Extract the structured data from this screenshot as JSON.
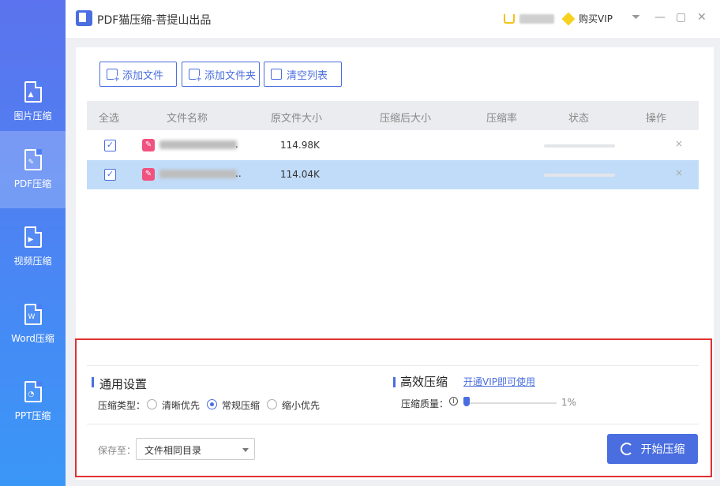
{
  "app": {
    "title": "PDF猫压缩-菩提山出品",
    "buy_vip": "购买VIP"
  },
  "sidebar": {
    "items": [
      {
        "label": "图片压缩",
        "icon": "image-file-icon"
      },
      {
        "label": "PDF压缩",
        "icon": "pdf-file-icon"
      },
      {
        "label": "视频压缩",
        "icon": "video-file-icon"
      },
      {
        "label": "Word压缩",
        "icon": "word-file-icon"
      },
      {
        "label": "PPT压缩",
        "icon": "ppt-file-icon"
      }
    ],
    "active": "PDF压缩"
  },
  "toolbar": {
    "add_file": "添加文件",
    "add_folder": "添加文件夹",
    "clear_list": "清空列表"
  },
  "table": {
    "headers": [
      "全选",
      "文件名称",
      "原文件大小",
      "压缩后大小",
      "压缩率",
      "状态",
      "操作"
    ],
    "rows": [
      {
        "checked": true,
        "name_suffix": ".",
        "size": "114.98K",
        "compressed": "",
        "ratio": "",
        "status": ""
      },
      {
        "checked": true,
        "name_suffix": "..",
        "size": "114.04K",
        "compressed": "",
        "ratio": "",
        "status": ""
      }
    ]
  },
  "settings": {
    "general_title": "通用设置",
    "compress_type_label": "压缩类型：",
    "options": [
      "清晰优先",
      "常规压缩",
      "缩小优先"
    ],
    "selected_option": "常规压缩",
    "efficient_title": "高效压缩",
    "vip_link": "开通VIP即可使用",
    "quality_label": "压缩质量：",
    "quality_value": "1%",
    "quality_fraction": 0.01,
    "save_to_label": "保存至：",
    "save_to_value": "文件相同目录",
    "start_button": "开始压缩"
  },
  "colors": {
    "accent": "#4a6ee0",
    "sidebar_gradient_top": "#5b73ee",
    "sidebar_gradient_bottom": "#3a97f7",
    "pdf_icon": "#f0517e",
    "selected_row": "#c1dcf9",
    "highlight_frame": "#e03131"
  }
}
